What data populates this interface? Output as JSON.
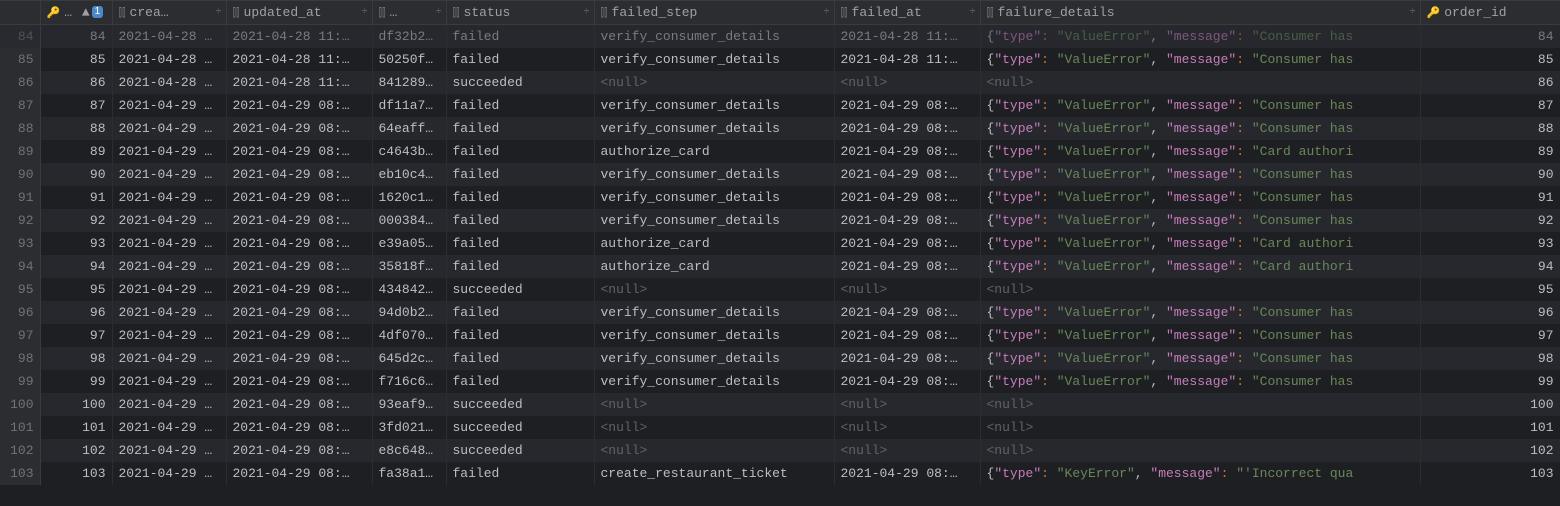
{
  "columns": {
    "id_label": "…",
    "created_label": "crea…",
    "updated_label": "updated_at",
    "corr_label": "…",
    "status_label": "status",
    "failed_step_label": "failed_step",
    "failed_at_label": "failed_at",
    "failure_details_label": "failure_details",
    "order_id_label": "order_id",
    "sort_num": "1"
  },
  "null_text": "<null>",
  "json_parts": {
    "open": "{",
    "k_type": "\"type\"",
    "k_message": "\"message\"",
    "colon": ":",
    "comma": ","
  },
  "rows": [
    {
      "n": 84,
      "id": 84,
      "created": "2021-04-28 …",
      "updated": "2021-04-28 11:…",
      "corr": "df32b2…",
      "status": "failed",
      "fstep": "verify_consumer_details",
      "fat": "2021-04-28 11:…",
      "err_type": "\"ValueError\"",
      "err_msg": "\"Consumer has",
      "order": 84,
      "faded": true
    },
    {
      "n": 85,
      "id": 85,
      "created": "2021-04-28 …",
      "updated": "2021-04-28 11:…",
      "corr": "50250f…",
      "status": "failed",
      "fstep": "verify_consumer_details",
      "fat": "2021-04-28 11:…",
      "err_type": "\"ValueError\"",
      "err_msg": "\"Consumer has",
      "order": 85
    },
    {
      "n": 86,
      "id": 86,
      "created": "2021-04-28 …",
      "updated": "2021-04-28 11:…",
      "corr": "841289…",
      "status": "succeeded",
      "fstep": null,
      "fat": null,
      "err_type": null,
      "err_msg": null,
      "order": 86
    },
    {
      "n": 87,
      "id": 87,
      "created": "2021-04-29 …",
      "updated": "2021-04-29 08:…",
      "corr": "df11a7…",
      "status": "failed",
      "fstep": "verify_consumer_details",
      "fat": "2021-04-29 08:…",
      "err_type": "\"ValueError\"",
      "err_msg": "\"Consumer has",
      "order": 87
    },
    {
      "n": 88,
      "id": 88,
      "created": "2021-04-29 …",
      "updated": "2021-04-29 08:…",
      "corr": "64eaff…",
      "status": "failed",
      "fstep": "verify_consumer_details",
      "fat": "2021-04-29 08:…",
      "err_type": "\"ValueError\"",
      "err_msg": "\"Consumer has",
      "order": 88
    },
    {
      "n": 89,
      "id": 89,
      "created": "2021-04-29 …",
      "updated": "2021-04-29 08:…",
      "corr": "c4643b…",
      "status": "failed",
      "fstep": "authorize_card",
      "fat": "2021-04-29 08:…",
      "err_type": "\"ValueError\"",
      "err_msg": "\"Card authori",
      "order": 89
    },
    {
      "n": 90,
      "id": 90,
      "created": "2021-04-29 …",
      "updated": "2021-04-29 08:…",
      "corr": "eb10c4…",
      "status": "failed",
      "fstep": "verify_consumer_details",
      "fat": "2021-04-29 08:…",
      "err_type": "\"ValueError\"",
      "err_msg": "\"Consumer has",
      "order": 90
    },
    {
      "n": 91,
      "id": 91,
      "created": "2021-04-29 …",
      "updated": "2021-04-29 08:…",
      "corr": "1620c1…",
      "status": "failed",
      "fstep": "verify_consumer_details",
      "fat": "2021-04-29 08:…",
      "err_type": "\"ValueError\"",
      "err_msg": "\"Consumer has",
      "order": 91
    },
    {
      "n": 92,
      "id": 92,
      "created": "2021-04-29 …",
      "updated": "2021-04-29 08:…",
      "corr": "000384…",
      "status": "failed",
      "fstep": "verify_consumer_details",
      "fat": "2021-04-29 08:…",
      "err_type": "\"ValueError\"",
      "err_msg": "\"Consumer has",
      "order": 92
    },
    {
      "n": 93,
      "id": 93,
      "created": "2021-04-29 …",
      "updated": "2021-04-29 08:…",
      "corr": "e39a05…",
      "status": "failed",
      "fstep": "authorize_card",
      "fat": "2021-04-29 08:…",
      "err_type": "\"ValueError\"",
      "err_msg": "\"Card authori",
      "order": 93
    },
    {
      "n": 94,
      "id": 94,
      "created": "2021-04-29 …",
      "updated": "2021-04-29 08:…",
      "corr": "35818f…",
      "status": "failed",
      "fstep": "authorize_card",
      "fat": "2021-04-29 08:…",
      "err_type": "\"ValueError\"",
      "err_msg": "\"Card authori",
      "order": 94
    },
    {
      "n": 95,
      "id": 95,
      "created": "2021-04-29 …",
      "updated": "2021-04-29 08:…",
      "corr": "434842…",
      "status": "succeeded",
      "fstep": null,
      "fat": null,
      "err_type": null,
      "err_msg": null,
      "order": 95
    },
    {
      "n": 96,
      "id": 96,
      "created": "2021-04-29 …",
      "updated": "2021-04-29 08:…",
      "corr": "94d0b2…",
      "status": "failed",
      "fstep": "verify_consumer_details",
      "fat": "2021-04-29 08:…",
      "err_type": "\"ValueError\"",
      "err_msg": "\"Consumer has",
      "order": 96
    },
    {
      "n": 97,
      "id": 97,
      "created": "2021-04-29 …",
      "updated": "2021-04-29 08:…",
      "corr": "4df070…",
      "status": "failed",
      "fstep": "verify_consumer_details",
      "fat": "2021-04-29 08:…",
      "err_type": "\"ValueError\"",
      "err_msg": "\"Consumer has",
      "order": 97
    },
    {
      "n": 98,
      "id": 98,
      "created": "2021-04-29 …",
      "updated": "2021-04-29 08:…",
      "corr": "645d2c…",
      "status": "failed",
      "fstep": "verify_consumer_details",
      "fat": "2021-04-29 08:…",
      "err_type": "\"ValueError\"",
      "err_msg": "\"Consumer has",
      "order": 98
    },
    {
      "n": 99,
      "id": 99,
      "created": "2021-04-29 …",
      "updated": "2021-04-29 08:…",
      "corr": "f716c6…",
      "status": "failed",
      "fstep": "verify_consumer_details",
      "fat": "2021-04-29 08:…",
      "err_type": "\"ValueError\"",
      "err_msg": "\"Consumer has",
      "order": 99
    },
    {
      "n": 100,
      "id": 100,
      "created": "2021-04-29 …",
      "updated": "2021-04-29 08:…",
      "corr": "93eaf9…",
      "status": "succeeded",
      "fstep": null,
      "fat": null,
      "err_type": null,
      "err_msg": null,
      "order": 100
    },
    {
      "n": 101,
      "id": 101,
      "created": "2021-04-29 …",
      "updated": "2021-04-29 08:…",
      "corr": "3fd021…",
      "status": "succeeded",
      "fstep": null,
      "fat": null,
      "err_type": null,
      "err_msg": null,
      "order": 101
    },
    {
      "n": 102,
      "id": 102,
      "created": "2021-04-29 …",
      "updated": "2021-04-29 08:…",
      "corr": "e8c648…",
      "status": "succeeded",
      "fstep": null,
      "fat": null,
      "err_type": null,
      "err_msg": null,
      "order": 102
    },
    {
      "n": 103,
      "id": 103,
      "created": "2021-04-29 …",
      "updated": "2021-04-29 08:…",
      "corr": "fa38a1…",
      "status": "failed",
      "fstep": "create_restaurant_ticket",
      "fat": "2021-04-29 08:…",
      "err_type": "\"KeyError\"",
      "err_msg": "\"'Incorrect qua",
      "order": 103
    }
  ]
}
